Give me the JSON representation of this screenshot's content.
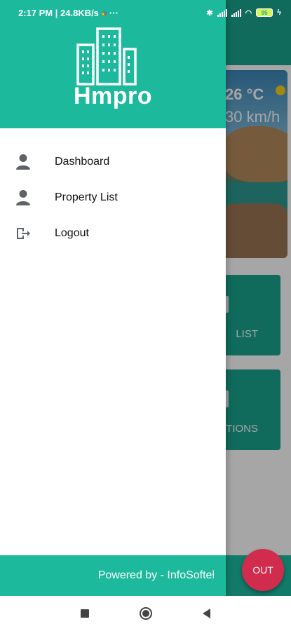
{
  "status_bar": {
    "time_speed": "2:17 PM | 24.8KB/s",
    "more": "···",
    "battery": "95"
  },
  "background": {
    "weather": {
      "temperature": "26 °C",
      "wind": "30 km/h"
    },
    "cards": [
      {
        "label": "LIST"
      },
      {
        "label": "TIONS"
      }
    ],
    "fab_label": "OUT"
  },
  "drawer": {
    "brand": "Hmpro",
    "menu": [
      {
        "label": "Dashboard",
        "icon": "person-icon"
      },
      {
        "label": "Property List",
        "icon": "person-icon"
      },
      {
        "label": "Logout",
        "icon": "logout-icon"
      }
    ],
    "footer": "Powered by - InfoSoftel"
  },
  "colors": {
    "primary": "#1cb99c",
    "primary_dark": "#1aa58e",
    "fab": "#d12c4d"
  }
}
